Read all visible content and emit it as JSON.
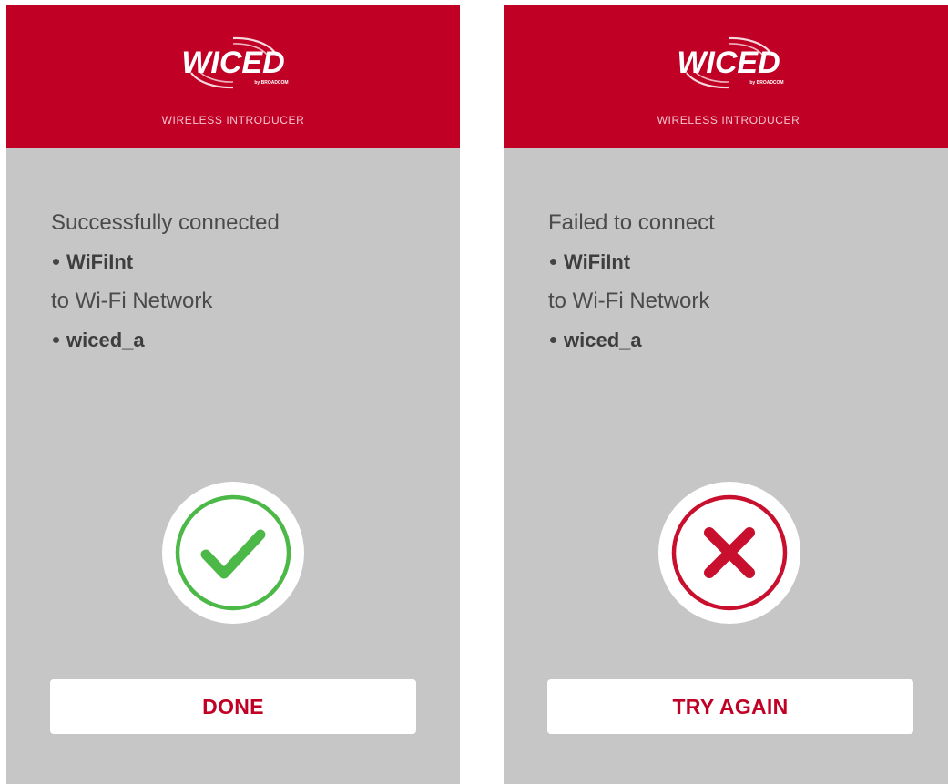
{
  "colors": {
    "brand_red": "#c10025",
    "background_gray": "#c6c6c6",
    "success_green": "#4cb848",
    "failure_red": "#c8102e"
  },
  "screens": [
    {
      "logo": {
        "icon": "wiced-logo-icon",
        "text": "WICED",
        "byline": "by BROADCOM"
      },
      "header_title": "WIRELESS INTRODUCER",
      "status_line": "Successfully connected",
      "device_name": "WiFiInt",
      "network_line": "to Wi-Fi Network",
      "network_name": "wiced_a",
      "result_icon": "checkmark-icon",
      "button_label": "DONE"
    },
    {
      "logo": {
        "icon": "wiced-logo-icon",
        "text": "WICED",
        "byline": "by BROADCOM"
      },
      "header_title": "WIRELESS INTRODUCER",
      "status_line": "Failed to connect",
      "device_name": "WiFiInt",
      "network_line": "to Wi-Fi Network",
      "network_name": "wiced_a",
      "result_icon": "x-mark-icon",
      "button_label": "TRY AGAIN"
    }
  ]
}
